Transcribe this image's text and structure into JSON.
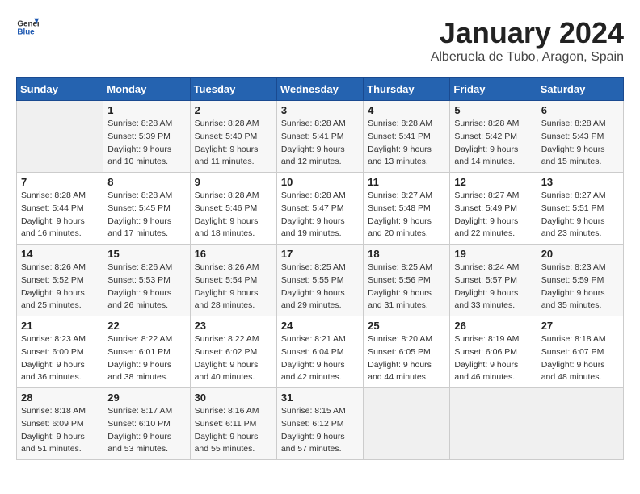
{
  "header": {
    "logo": {
      "general": "General",
      "blue": "Blue"
    },
    "title": "January 2024",
    "subtitle": "Alberuela de Tubo, Aragon, Spain"
  },
  "days_of_week": [
    "Sunday",
    "Monday",
    "Tuesday",
    "Wednesday",
    "Thursday",
    "Friday",
    "Saturday"
  ],
  "weeks": [
    [
      {
        "day": "",
        "sunrise": "",
        "sunset": "",
        "daylight": ""
      },
      {
        "day": "1",
        "sunrise": "Sunrise: 8:28 AM",
        "sunset": "Sunset: 5:39 PM",
        "daylight": "Daylight: 9 hours and 10 minutes."
      },
      {
        "day": "2",
        "sunrise": "Sunrise: 8:28 AM",
        "sunset": "Sunset: 5:40 PM",
        "daylight": "Daylight: 9 hours and 11 minutes."
      },
      {
        "day": "3",
        "sunrise": "Sunrise: 8:28 AM",
        "sunset": "Sunset: 5:41 PM",
        "daylight": "Daylight: 9 hours and 12 minutes."
      },
      {
        "day": "4",
        "sunrise": "Sunrise: 8:28 AM",
        "sunset": "Sunset: 5:41 PM",
        "daylight": "Daylight: 9 hours and 13 minutes."
      },
      {
        "day": "5",
        "sunrise": "Sunrise: 8:28 AM",
        "sunset": "Sunset: 5:42 PM",
        "daylight": "Daylight: 9 hours and 14 minutes."
      },
      {
        "day": "6",
        "sunrise": "Sunrise: 8:28 AM",
        "sunset": "Sunset: 5:43 PM",
        "daylight": "Daylight: 9 hours and 15 minutes."
      }
    ],
    [
      {
        "day": "7",
        "sunrise": "Sunrise: 8:28 AM",
        "sunset": "Sunset: 5:44 PM",
        "daylight": "Daylight: 9 hours and 16 minutes."
      },
      {
        "day": "8",
        "sunrise": "Sunrise: 8:28 AM",
        "sunset": "Sunset: 5:45 PM",
        "daylight": "Daylight: 9 hours and 17 minutes."
      },
      {
        "day": "9",
        "sunrise": "Sunrise: 8:28 AM",
        "sunset": "Sunset: 5:46 PM",
        "daylight": "Daylight: 9 hours and 18 minutes."
      },
      {
        "day": "10",
        "sunrise": "Sunrise: 8:28 AM",
        "sunset": "Sunset: 5:47 PM",
        "daylight": "Daylight: 9 hours and 19 minutes."
      },
      {
        "day": "11",
        "sunrise": "Sunrise: 8:27 AM",
        "sunset": "Sunset: 5:48 PM",
        "daylight": "Daylight: 9 hours and 20 minutes."
      },
      {
        "day": "12",
        "sunrise": "Sunrise: 8:27 AM",
        "sunset": "Sunset: 5:49 PM",
        "daylight": "Daylight: 9 hours and 22 minutes."
      },
      {
        "day": "13",
        "sunrise": "Sunrise: 8:27 AM",
        "sunset": "Sunset: 5:51 PM",
        "daylight": "Daylight: 9 hours and 23 minutes."
      }
    ],
    [
      {
        "day": "14",
        "sunrise": "Sunrise: 8:26 AM",
        "sunset": "Sunset: 5:52 PM",
        "daylight": "Daylight: 9 hours and 25 minutes."
      },
      {
        "day": "15",
        "sunrise": "Sunrise: 8:26 AM",
        "sunset": "Sunset: 5:53 PM",
        "daylight": "Daylight: 9 hours and 26 minutes."
      },
      {
        "day": "16",
        "sunrise": "Sunrise: 8:26 AM",
        "sunset": "Sunset: 5:54 PM",
        "daylight": "Daylight: 9 hours and 28 minutes."
      },
      {
        "day": "17",
        "sunrise": "Sunrise: 8:25 AM",
        "sunset": "Sunset: 5:55 PM",
        "daylight": "Daylight: 9 hours and 29 minutes."
      },
      {
        "day": "18",
        "sunrise": "Sunrise: 8:25 AM",
        "sunset": "Sunset: 5:56 PM",
        "daylight": "Daylight: 9 hours and 31 minutes."
      },
      {
        "day": "19",
        "sunrise": "Sunrise: 8:24 AM",
        "sunset": "Sunset: 5:57 PM",
        "daylight": "Daylight: 9 hours and 33 minutes."
      },
      {
        "day": "20",
        "sunrise": "Sunrise: 8:23 AM",
        "sunset": "Sunset: 5:59 PM",
        "daylight": "Daylight: 9 hours and 35 minutes."
      }
    ],
    [
      {
        "day": "21",
        "sunrise": "Sunrise: 8:23 AM",
        "sunset": "Sunset: 6:00 PM",
        "daylight": "Daylight: 9 hours and 36 minutes."
      },
      {
        "day": "22",
        "sunrise": "Sunrise: 8:22 AM",
        "sunset": "Sunset: 6:01 PM",
        "daylight": "Daylight: 9 hours and 38 minutes."
      },
      {
        "day": "23",
        "sunrise": "Sunrise: 8:22 AM",
        "sunset": "Sunset: 6:02 PM",
        "daylight": "Daylight: 9 hours and 40 minutes."
      },
      {
        "day": "24",
        "sunrise": "Sunrise: 8:21 AM",
        "sunset": "Sunset: 6:04 PM",
        "daylight": "Daylight: 9 hours and 42 minutes."
      },
      {
        "day": "25",
        "sunrise": "Sunrise: 8:20 AM",
        "sunset": "Sunset: 6:05 PM",
        "daylight": "Daylight: 9 hours and 44 minutes."
      },
      {
        "day": "26",
        "sunrise": "Sunrise: 8:19 AM",
        "sunset": "Sunset: 6:06 PM",
        "daylight": "Daylight: 9 hours and 46 minutes."
      },
      {
        "day": "27",
        "sunrise": "Sunrise: 8:18 AM",
        "sunset": "Sunset: 6:07 PM",
        "daylight": "Daylight: 9 hours and 48 minutes."
      }
    ],
    [
      {
        "day": "28",
        "sunrise": "Sunrise: 8:18 AM",
        "sunset": "Sunset: 6:09 PM",
        "daylight": "Daylight: 9 hours and 51 minutes."
      },
      {
        "day": "29",
        "sunrise": "Sunrise: 8:17 AM",
        "sunset": "Sunset: 6:10 PM",
        "daylight": "Daylight: 9 hours and 53 minutes."
      },
      {
        "day": "30",
        "sunrise": "Sunrise: 8:16 AM",
        "sunset": "Sunset: 6:11 PM",
        "daylight": "Daylight: 9 hours and 55 minutes."
      },
      {
        "day": "31",
        "sunrise": "Sunrise: 8:15 AM",
        "sunset": "Sunset: 6:12 PM",
        "daylight": "Daylight: 9 hours and 57 minutes."
      },
      {
        "day": "",
        "sunrise": "",
        "sunset": "",
        "daylight": ""
      },
      {
        "day": "",
        "sunrise": "",
        "sunset": "",
        "daylight": ""
      },
      {
        "day": "",
        "sunrise": "",
        "sunset": "",
        "daylight": ""
      }
    ]
  ]
}
